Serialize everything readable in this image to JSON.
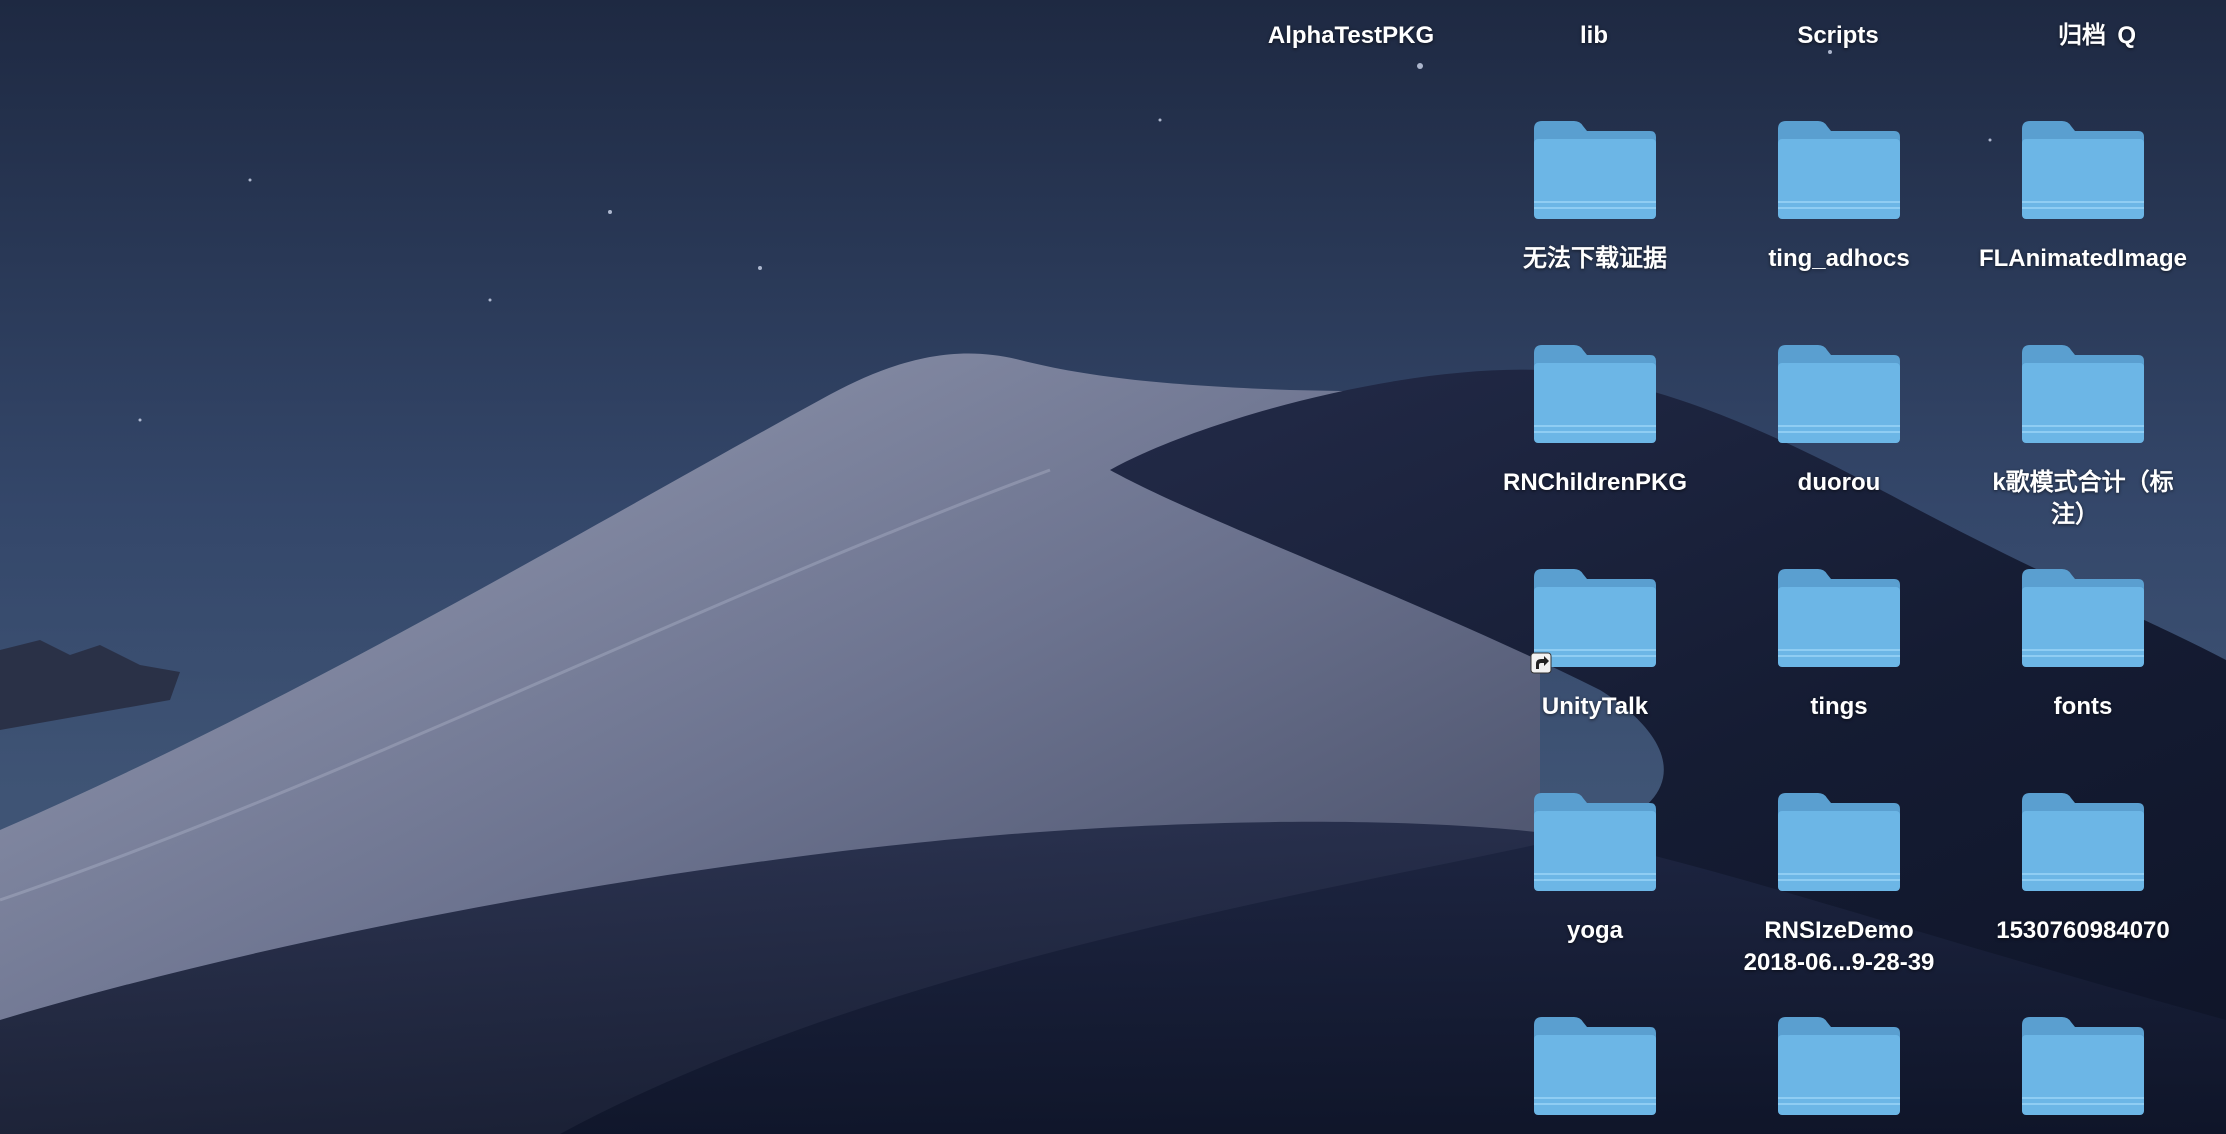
{
  "desktop": {
    "top_row_labels": [
      "AlphaTestPKG",
      "lib",
      "Scripts",
      "归档",
      "Q"
    ],
    "folders": [
      {
        "label": "无法下载证据",
        "icon": "folder-icon"
      },
      {
        "label": "ting_adhocs",
        "icon": "folder-icon"
      },
      {
        "label": "FLAnimatedImage",
        "icon": "folder-icon"
      },
      {
        "label": "RNChildrenPKG",
        "icon": "folder-icon"
      },
      {
        "label": "duorou",
        "icon": "folder-icon"
      },
      {
        "label": "k歌模式合计（标",
        "label_line2": "注）",
        "icon": "folder-icon"
      },
      {
        "label": "UnityTalk",
        "icon": "folder-alias-icon"
      },
      {
        "label": "tings",
        "icon": "folder-icon"
      },
      {
        "label": "fonts",
        "icon": "folder-icon"
      },
      {
        "label": "yoga",
        "icon": "folder-icon"
      },
      {
        "label": "RNSIzeDemo",
        "label_line2": "2018-06...9-28-39",
        "icon": "folder-icon"
      },
      {
        "label": "1530760984070",
        "icon": "folder-icon"
      },
      {
        "label": "",
        "icon": "folder-icon"
      },
      {
        "label": "",
        "icon": "folder-icon"
      },
      {
        "label": "",
        "icon": "folder-icon"
      }
    ]
  },
  "colors": {
    "sky_top": "#1f2a44",
    "sky_mid": "#3d4f6e",
    "dune_light": "#8a90a8",
    "dune_dark": "#141b30",
    "folder_front": "#6cb6e6",
    "folder_back": "#5a9fd0"
  }
}
